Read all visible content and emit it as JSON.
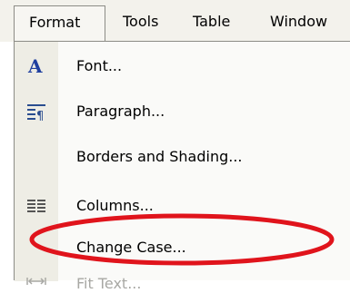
{
  "menubar": {
    "items": [
      {
        "label": "Format",
        "mnemonic_char": "o"
      },
      {
        "label": "Tools",
        "mnemonic_char": "T"
      },
      {
        "label": "Table",
        "mnemonic_char": "a"
      },
      {
        "label": "Window",
        "mnemonic_char": "W"
      }
    ],
    "open_menu": "Format"
  },
  "format_menu": {
    "items": [
      {
        "label": "Font...",
        "icon": "font-a-icon",
        "mnemonic_char": "F"
      },
      {
        "label": "Paragraph...",
        "icon": "paragraph-icon",
        "mnemonic_char": "P"
      },
      {
        "label": "Borders and Shading...",
        "icon": "",
        "mnemonic_char": "B"
      },
      {
        "label": "Columns...",
        "icon": "columns-icon",
        "mnemonic_char": "C"
      },
      {
        "label": "Change Case...",
        "icon": "",
        "mnemonic_char": "e"
      },
      {
        "label": "Fit Text...",
        "icon": "fit-text-icon",
        "disabled": true
      }
    ]
  },
  "annotation": {
    "color": "#e0141c",
    "target": "Change Case..."
  },
  "colors": {
    "menu_bg": "#f3f2ec",
    "icon_strip": "#eeede5",
    "border": "#8c8c86",
    "font_icon_blue": "#1f3f9f"
  }
}
